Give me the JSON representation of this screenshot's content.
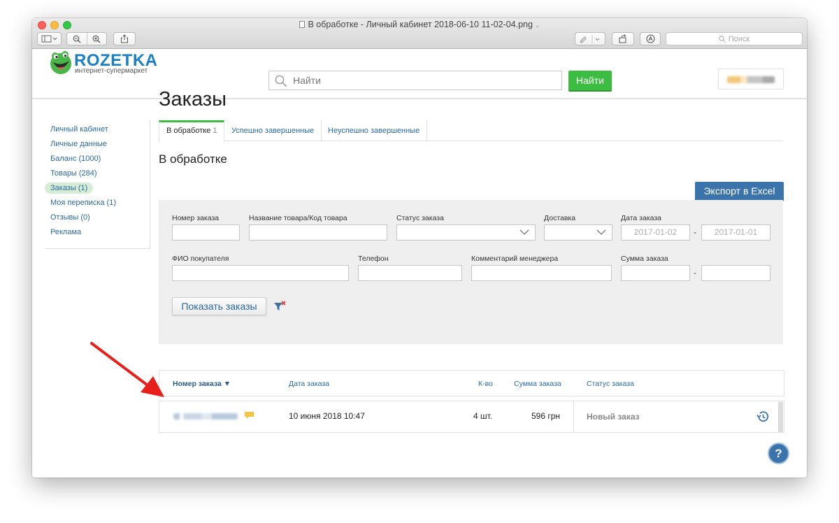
{
  "window": {
    "title": "В обработке - Личный кабинет 2018-06-10 11-02-04.png",
    "search_placeholder": "Поиск"
  },
  "header": {
    "logo_name": "ROZETKA",
    "logo_tagline": "интернет-супермаркет",
    "search_placeholder": "Найти",
    "search_button": "Найти"
  },
  "sidebar": {
    "items": [
      {
        "label": "Личный кабинет",
        "active": false
      },
      {
        "label": "Личные данные",
        "active": false
      },
      {
        "label": "Баланс (1000)",
        "active": false
      },
      {
        "label": "Товары (284)",
        "active": false
      },
      {
        "label": "Заказы (1)",
        "active": true
      },
      {
        "label": "Моя переписка (1)",
        "active": false
      },
      {
        "label": "Отзывы (0)",
        "active": false
      },
      {
        "label": "Реклама",
        "active": false
      }
    ]
  },
  "main": {
    "title": "Заказы",
    "tabs": [
      {
        "label": "В обработке",
        "count": "1",
        "active": true
      },
      {
        "label": "Успешно завершенные",
        "count": "",
        "active": false
      },
      {
        "label": "Неуспешно завершенные",
        "count": "",
        "active": false
      }
    ],
    "section_title": "В обработке",
    "export_button": "Экспорт в Excel"
  },
  "filters": {
    "order_number": {
      "label": "Номер заказа",
      "value": ""
    },
    "product": {
      "label": "Название товара/Код товара",
      "value": ""
    },
    "status": {
      "label": "Статус заказа",
      "value": ""
    },
    "delivery": {
      "label": "Доставка",
      "value": ""
    },
    "date": {
      "label": "Дата заказа",
      "from_placeholder": "2017-01-02",
      "to_placeholder": "2017-01-01"
    },
    "buyer": {
      "label": "ФИО покупателя",
      "value": ""
    },
    "phone": {
      "label": "Телефон",
      "value": ""
    },
    "manager_comment": {
      "label": "Комментарий менеджера",
      "value": ""
    },
    "sum": {
      "label": "Сумма заказа",
      "from": "",
      "to": ""
    },
    "separator": "-",
    "show_button": "Показать заказы"
  },
  "orders": {
    "columns": [
      "Номер заказа ▼",
      "Дата заказа",
      "К-во",
      "Сумма заказа",
      "Статус заказа"
    ],
    "rows": [
      {
        "date": "10 июня 2018 10:47",
        "qty": "4 шт.",
        "sum": "596 грн",
        "status": "Новый заказ"
      }
    ]
  },
  "help": {
    "label": "?"
  },
  "colors": {
    "brand_blue": "#1b7fc4",
    "find_green": "#3cbd41",
    "export_blue": "#3b73ab",
    "link_blue": "#2a6aa4",
    "annotation_red": "#e8201c"
  }
}
